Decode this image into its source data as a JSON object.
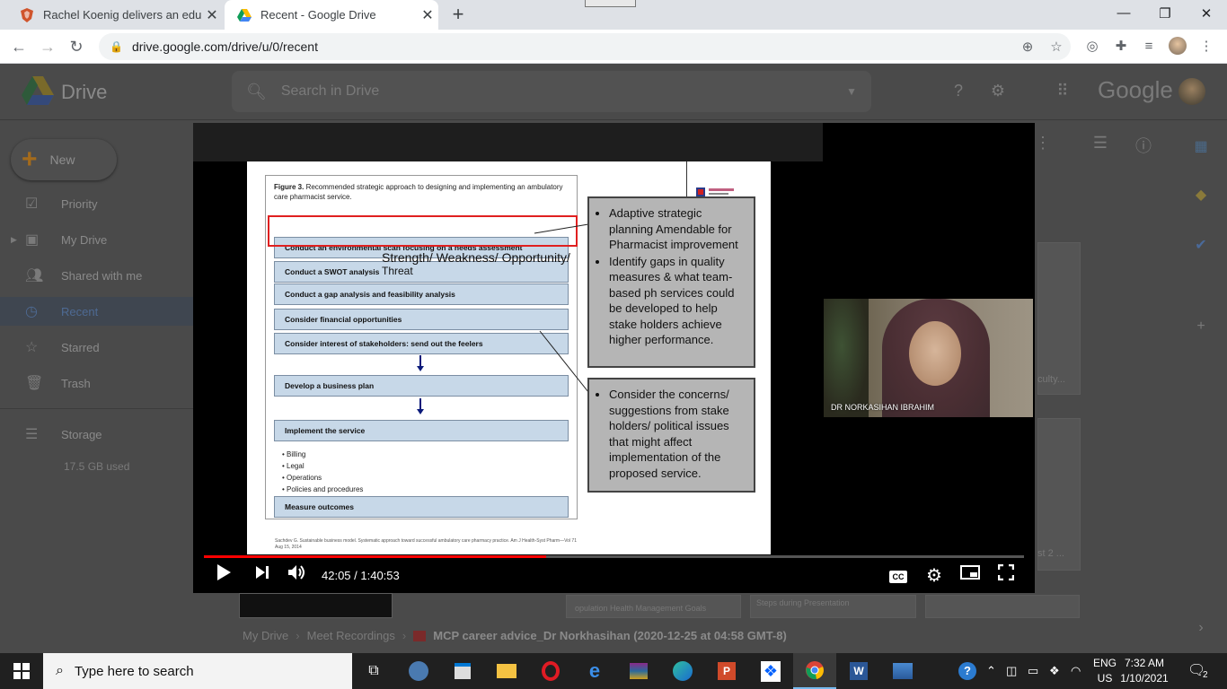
{
  "browser": {
    "tabs": [
      {
        "title": "Rachel Koenig delivers an educat",
        "icon": "brave-shield-icon"
      },
      {
        "title": "Recent - Google Drive",
        "icon": "google-drive-icon"
      }
    ],
    "url": "drive.google.com/drive/u/0/recent"
  },
  "drive": {
    "app_name": "Drive",
    "search_placeholder": "Search in Drive",
    "google_wordmark": "Google",
    "new_label": "New",
    "nav": [
      {
        "label": "Priority",
        "icon": "checkbox-icon"
      },
      {
        "label": "My Drive",
        "icon": "my-drive-icon"
      },
      {
        "label": "Shared with me",
        "icon": "people-icon"
      },
      {
        "label": "Recent",
        "icon": "clock-icon"
      },
      {
        "label": "Starred",
        "icon": "star-icon"
      },
      {
        "label": "Trash",
        "icon": "trash-icon"
      },
      {
        "label": "Storage",
        "icon": "storage-icon"
      }
    ],
    "storage_used": "17.5 GB used",
    "breadcrumb": {
      "root": "My Drive",
      "folder": "Meet Recordings",
      "current": "MCP career advice_Dr Norkhasihan (2020-12-25 at 04:58 GMT-8)"
    },
    "file_captions": [
      "culty...",
      "st 2 ...",
      "opulation Health Management Goals",
      "Steps during Presentation"
    ]
  },
  "video": {
    "current_time": "42:05",
    "duration": "1:40:53",
    "progress": 0.417,
    "time_display": "42:05 / 1:40:53",
    "speaker_name": "DR NORKASIHAN IBRAHIM",
    "slide": {
      "figure_title_bold": "Figure 3.",
      "figure_title": "Recommended strategic approach to designing and implementing an ambulatory care pharmacist service.",
      "steps": [
        "Conduct an environmental scan focusing on a needs assessment",
        "Conduct a SWOT analysis",
        "Conduct a gap analysis and feasibility analysis",
        "Consider financial opportunities",
        "Consider interest of stakeholders: send out the feelers",
        "Develop a business plan",
        "Implement the service",
        "Measure outcomes"
      ],
      "implement_items": [
        "Billing",
        "Legal",
        "Operations",
        "Policies and procedures"
      ],
      "overlay_text_line1": "Strength/ Weakness/ Opportunity/",
      "overlay_text_line2": "Threat",
      "callout_top": [
        "Adaptive strategic planning Amendable for Pharmacist improvement",
        "Identify gaps in quality measures & what team-based ph services could be developed to help stake holders achieve higher performance."
      ],
      "callout_bottom": [
        "Consider the concerns/ suggestions from stake holders/ political issues that might affect implementation of the proposed service."
      ],
      "citation": "Sachdev G. Sustainable business model. Systematic approach toward successful ambulatory care pharmacy practice. Am J Health-Syst Pharm—Vol 71 Aug 15, 2014"
    }
  },
  "taskbar": {
    "search_placeholder": "Type here to search",
    "lang_line1": "ENG",
    "lang_line2": "US",
    "time": "7:32 AM",
    "date": "1/10/2021",
    "notification_count": "2"
  }
}
